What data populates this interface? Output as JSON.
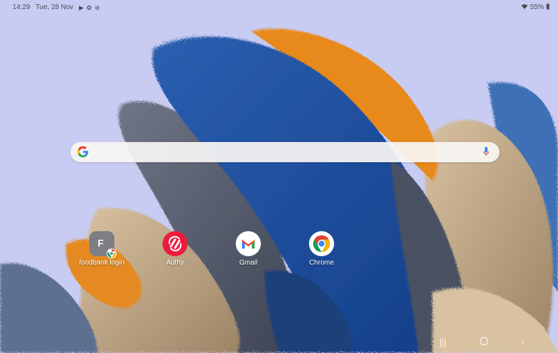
{
  "status_bar": {
    "time": "14:29",
    "date": "Tue, 28 Nov",
    "notification_icons": [
      "play-store-icon",
      "gear-icon",
      "sync-icon"
    ],
    "wifi_icon": "wifi-icon",
    "battery_level": "55%",
    "battery_icon": "battery-icon"
  },
  "search": {
    "logo": "google-logo",
    "mic_icon": "mic-icon",
    "placeholder": ""
  },
  "apps": [
    {
      "label": "foodbank login",
      "icon": "foodbank-shortcut-icon",
      "letter": "F"
    },
    {
      "label": "Authy",
      "icon": "authy-icon"
    },
    {
      "label": "Gmail",
      "icon": "gmail-icon"
    },
    {
      "label": "Chrome",
      "icon": "chrome-icon"
    }
  ],
  "navigation": {
    "recents": "recents-icon",
    "home": "home-icon",
    "back": "back-icon"
  },
  "colors": {
    "authy": "#ec1c3e",
    "gmail_red": "#ea4335",
    "chrome_red": "#db4437",
    "chrome_yellow": "#f4b400",
    "chrome_green": "#0f9d58",
    "chrome_blue": "#4285f4"
  }
}
